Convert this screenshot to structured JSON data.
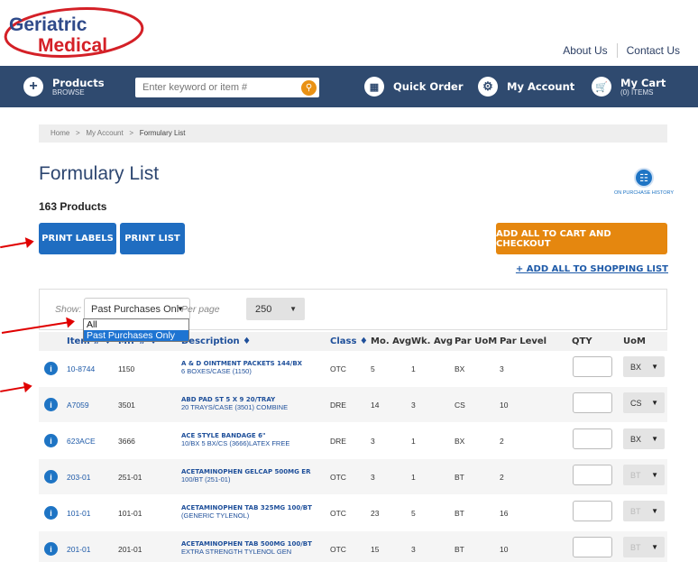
{
  "header": {
    "logo_line1": "Geriatric",
    "logo_line2": "Medical",
    "about": "About Us",
    "contact": "Contact Us"
  },
  "nav": {
    "products_title": "Products",
    "products_sub": "BROWSE",
    "search_placeholder": "Enter keyword or item #",
    "quick_order": "Quick Order",
    "my_account": "My Account",
    "cart_title": "My Cart",
    "cart_sub": "(0) ITEMS"
  },
  "breadcrumb": {
    "home": "Home",
    "account": "My Account",
    "current": "Formulary List",
    "sep": ">"
  },
  "page": {
    "title": "Formulary List",
    "count": "163 Products",
    "history_label": "ON PURCHASE HISTORY",
    "print_labels": "PRINT LABELS",
    "print_list": "PRINT LIST",
    "add_all_cart": "ADD ALL TO CART AND CHECKOUT",
    "add_all_list": "+ ADD ALL TO SHOPPING LIST"
  },
  "filter": {
    "show_label": "Show:",
    "show_value": "Past Purchases Onl",
    "options": [
      "All",
      "Past Purchases Only"
    ],
    "perpage_label": "Per page",
    "perpage_value": "250"
  },
  "table": {
    "headers": {
      "item": "Item # ♦",
      "mfr": "Mfr # ♦",
      "desc": "Description ♦",
      "class": "Class ♦",
      "mo": "Mo. Avg",
      "wk": "Wk. Avg",
      "paruom": "Par UoM",
      "parlevel": "Par Level",
      "qty": "QTY",
      "uom": "UoM"
    },
    "rows": [
      {
        "item": "10-8744",
        "mfr": "1150",
        "d1": "A & D OINTMENT PACKETS 144/BX",
        "d2": "6 BOXES/CASE (1150)",
        "cls": "OTC",
        "mo": "5",
        "wk": "1",
        "paruom": "BX",
        "par": "3",
        "uom": "BX"
      },
      {
        "item": "A7059",
        "mfr": "3501",
        "d1": "ABD PAD ST 5 X 9 20/TRAY",
        "d2": "20 TRAYS/CASE (3501) COMBINE",
        "cls": "DRE",
        "mo": "14",
        "wk": "3",
        "paruom": "CS",
        "par": "10",
        "uom": "CS"
      },
      {
        "item": "623ACE",
        "mfr": "3666",
        "d1": "ACE STYLE BANDAGE 6\"",
        "d2": "10/BX 5 BX/CS (3666)LATEX FREE",
        "cls": "DRE",
        "mo": "3",
        "wk": "1",
        "paruom": "BX",
        "par": "2",
        "uom": "BX"
      },
      {
        "item": "203-01",
        "mfr": "251-01",
        "d1": "ACETAMINOPHEN GELCAP 500MG ER",
        "d2": "100/BT (251-01)",
        "cls": "OTC",
        "mo": "3",
        "wk": "1",
        "paruom": "BT",
        "par": "2",
        "uom": "BT"
      },
      {
        "item": "101-01",
        "mfr": "101-01",
        "d1": "ACETAMINOPHEN TAB 325MG 100/BT",
        "d2": "(GENERIC TYLENOL)",
        "cls": "OTC",
        "mo": "23",
        "wk": "5",
        "paruom": "BT",
        "par": "16",
        "uom": "BT"
      },
      {
        "item": "201-01",
        "mfr": "201-01",
        "d1": "ACETAMINOPHEN TAB 500MG 100/BT",
        "d2": "EXTRA STRENGTH TYLENOL GEN",
        "cls": "OTC",
        "mo": "15",
        "wk": "3",
        "paruom": "BT",
        "par": "10",
        "uom": "BT"
      }
    ]
  },
  "colors": {
    "nav": "#2f4a6f",
    "blue_button": "#1f6dc1",
    "orange_button": "#e5870f",
    "logo_red": "#d42027",
    "arrow": "#e00000"
  }
}
